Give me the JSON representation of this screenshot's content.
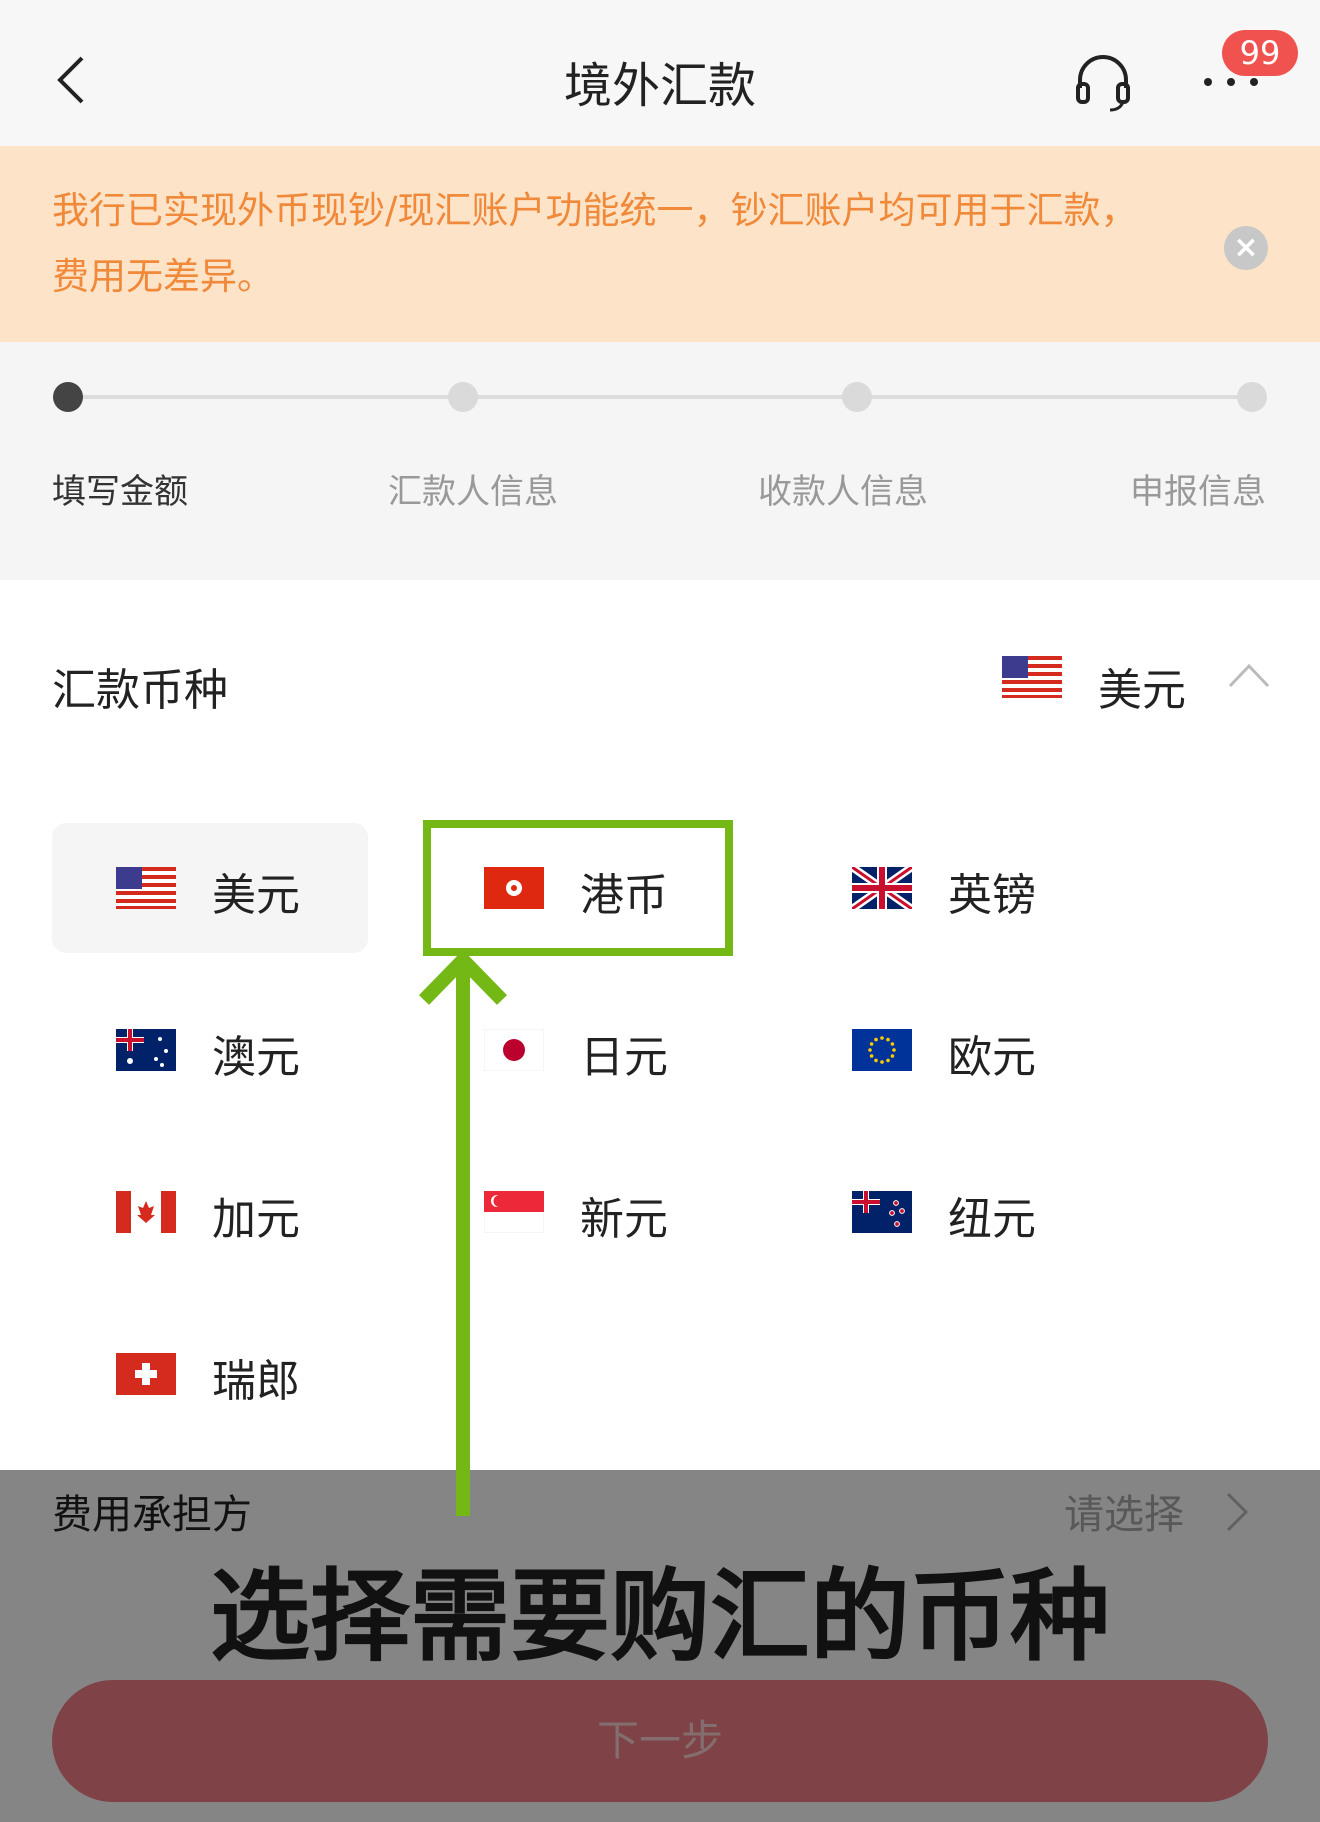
{
  "header": {
    "title": "境外汇款",
    "badge_count": "99"
  },
  "notice": {
    "text": "我行已实现外币现钞/现汇账户功能统一，钞汇账户均可用于汇款，费用无差异。"
  },
  "steps": [
    {
      "label": "填写金额",
      "active": true
    },
    {
      "label": "汇款人信息",
      "active": false
    },
    {
      "label": "收款人信息",
      "active": false
    },
    {
      "label": "申报信息",
      "active": false
    }
  ],
  "currency": {
    "label": "汇款币种",
    "selected": "美元",
    "options": [
      {
        "name": "美元",
        "flag": "us-flag-icon"
      },
      {
        "name": "港币",
        "flag": "hk-flag-icon"
      },
      {
        "name": "英镑",
        "flag": "uk-flag-icon"
      },
      {
        "name": "澳元",
        "flag": "au-flag-icon"
      },
      {
        "name": "日元",
        "flag": "jp-flag-icon"
      },
      {
        "name": "欧元",
        "flag": "eu-flag-icon"
      },
      {
        "name": "加元",
        "flag": "ca-flag-icon"
      },
      {
        "name": "新元",
        "flag": "sg-flag-icon"
      },
      {
        "name": "纽元",
        "flag": "nz-flag-icon"
      },
      {
        "name": "瑞郎",
        "flag": "ch-flag-icon"
      }
    ]
  },
  "fee": {
    "label": "费用承担方",
    "placeholder": "请选择"
  },
  "next_button": {
    "label": "下一步"
  },
  "annotation": {
    "text": "选择需要购汇的币种"
  },
  "colors": {
    "accent": "#f0524f",
    "notice_text": "#f0893a",
    "notice_bg": "#fde4c8",
    "annotation": "#74b816"
  }
}
